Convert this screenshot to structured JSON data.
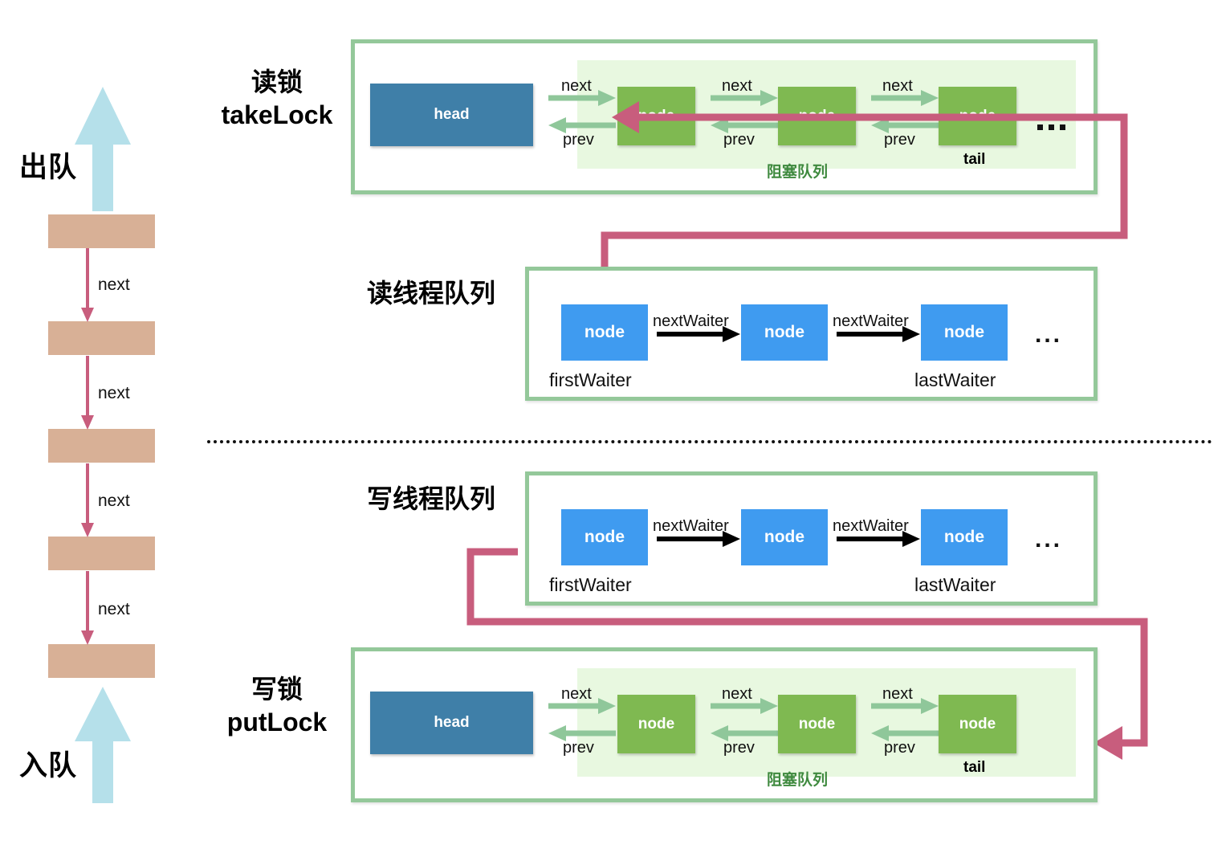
{
  "left_queue": {
    "dequeue_label": "出队",
    "enqueue_label": "入队",
    "next_labels": [
      "next",
      "next",
      "next",
      "next"
    ],
    "box_count": 5,
    "arrow_color": "#b5e0ea",
    "box_color": "#d8b096",
    "link_color": "#c85d7d"
  },
  "sections": {
    "take_lock": {
      "label_line1": "读锁",
      "label_line2": "takeLock",
      "head_label": "head",
      "nodes": [
        "node",
        "node",
        "node"
      ],
      "tail_label": "tail",
      "blocking_queue_label": "阻塞队列",
      "next_labels": [
        "next",
        "next",
        "next"
      ],
      "prev_labels": [
        "prev",
        "prev",
        "prev"
      ],
      "ellipsis": "..."
    },
    "read_thread_queue": {
      "label": "读线程队列",
      "nodes": [
        "node",
        "node",
        "node"
      ],
      "link_labels": [
        "nextWaiter",
        "nextWaiter"
      ],
      "first_waiter_label": "firstWaiter",
      "last_waiter_label": "lastWaiter",
      "ellipsis": "..."
    },
    "write_thread_queue": {
      "label": "写线程队列",
      "nodes": [
        "node",
        "node",
        "node"
      ],
      "link_labels": [
        "nextWaiter",
        "nextWaiter"
      ],
      "first_waiter_label": "firstWaiter",
      "last_waiter_label": "lastWaiter",
      "ellipsis": "..."
    },
    "put_lock": {
      "label_line1": "写锁",
      "label_line2": "putLock",
      "head_label": "head",
      "nodes": [
        "node",
        "node",
        "node"
      ],
      "tail_label": "tail",
      "blocking_queue_label": "阻塞队列",
      "next_labels": [
        "next",
        "next",
        "next"
      ],
      "prev_labels": [
        "prev",
        "prev",
        "prev"
      ]
    }
  },
  "colors": {
    "panel_border": "#94c89a",
    "blocking_band": "#e8f8e0",
    "head_box": "#3f7fa8",
    "green_node": "#7fb951",
    "blue_node": "#3f9bf0",
    "pink_link": "#c85d7d",
    "green_arrow": "#8fc79a",
    "tan_box": "#d8b096",
    "light_blue_arrow": "#b5e0ea"
  }
}
